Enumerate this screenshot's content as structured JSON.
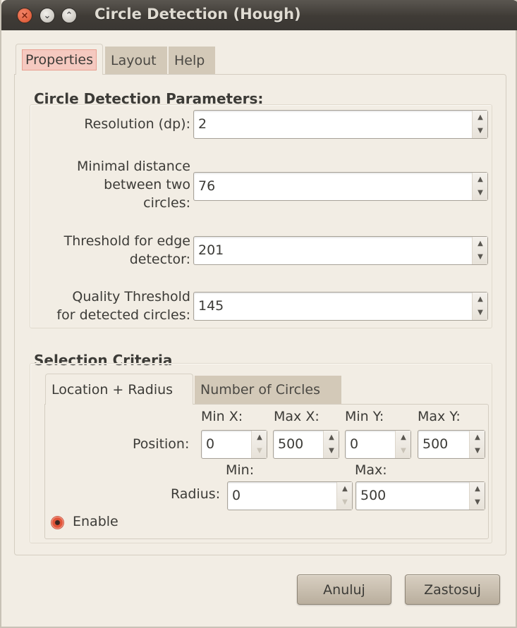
{
  "window": {
    "title": "Circle Detection (Hough)",
    "controls": {
      "close": "×",
      "minimize": "⌄",
      "maximize": "⌃"
    }
  },
  "tabs": [
    {
      "label": "Properties",
      "active": true
    },
    {
      "label": "Layout",
      "active": false
    },
    {
      "label": "Help",
      "active": false
    }
  ],
  "parameters": {
    "title": "Circle Detection Parameters:",
    "fields": [
      {
        "label_lines": [
          "Resolution (dp):"
        ],
        "value": "2"
      },
      {
        "label_lines": [
          "Minimal distance",
          "between two",
          "circles:"
        ],
        "value": "76"
      },
      {
        "label_lines": [
          "Threshold for edge",
          "detector:"
        ],
        "value": "201"
      },
      {
        "label_lines": [
          "Quality Threshold",
          "for detected circles:"
        ],
        "value": "145"
      }
    ]
  },
  "selection": {
    "title": "Selection Criteria",
    "tabs": [
      {
        "label": "Location + Radius",
        "active": true
      },
      {
        "label": "Number of Circles",
        "active": false
      }
    ],
    "position": {
      "label": "Position:",
      "columns": [
        {
          "header": "Min X:",
          "value": "0"
        },
        {
          "header": "Max X:",
          "value": "500"
        },
        {
          "header": "Min Y:",
          "value": "0"
        },
        {
          "header": "Max Y:",
          "value": "500"
        }
      ]
    },
    "radius": {
      "label": "Radius:",
      "min": {
        "header": "Min:",
        "value": "0"
      },
      "max": {
        "header": "Max:",
        "value": "500"
      }
    },
    "enable": {
      "label": "Enable",
      "checked": true
    }
  },
  "buttons": {
    "cancel": "Anuluj",
    "apply": "Zastosuj"
  },
  "icons": {
    "spin_up": "▲",
    "spin_down": "▼"
  }
}
